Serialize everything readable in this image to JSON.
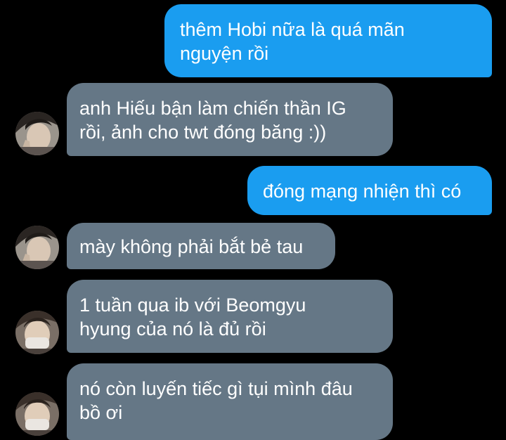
{
  "messages": [
    {
      "side": "sent",
      "lines": [
        "thêm Hobi nữa là quá mãn",
        "nguyện rồi"
      ]
    },
    {
      "side": "received",
      "lines": [
        "anh Hiếu bận làm chiến thần IG",
        "rồi, ảnh cho twt đóng băng :))"
      ]
    },
    {
      "side": "sent",
      "lines": [
        "đóng mạng nhiện thì có"
      ]
    },
    {
      "side": "received",
      "lines": [
        "mày không phải bắt bẻ tau"
      ]
    },
    {
      "side": "received",
      "lines": [
        "1 tuần qua ib với Beomgyu",
        "hyung của nó là đủ rồi"
      ]
    },
    {
      "side": "received",
      "lines": [
        "nó còn luyến tiếc gì tụi mình đâu",
        "bồ ơi"
      ]
    }
  ],
  "colors": {
    "background": "#000000",
    "sent_bubble": "#1a9df0",
    "received_bubble": "#657786",
    "text": "#ffffff"
  },
  "avatars": [
    {
      "icon": "user-avatar-1"
    },
    {
      "icon": "user-avatar-2"
    },
    {
      "icon": "user-avatar-3"
    },
    {
      "icon": "user-avatar-4"
    }
  ]
}
